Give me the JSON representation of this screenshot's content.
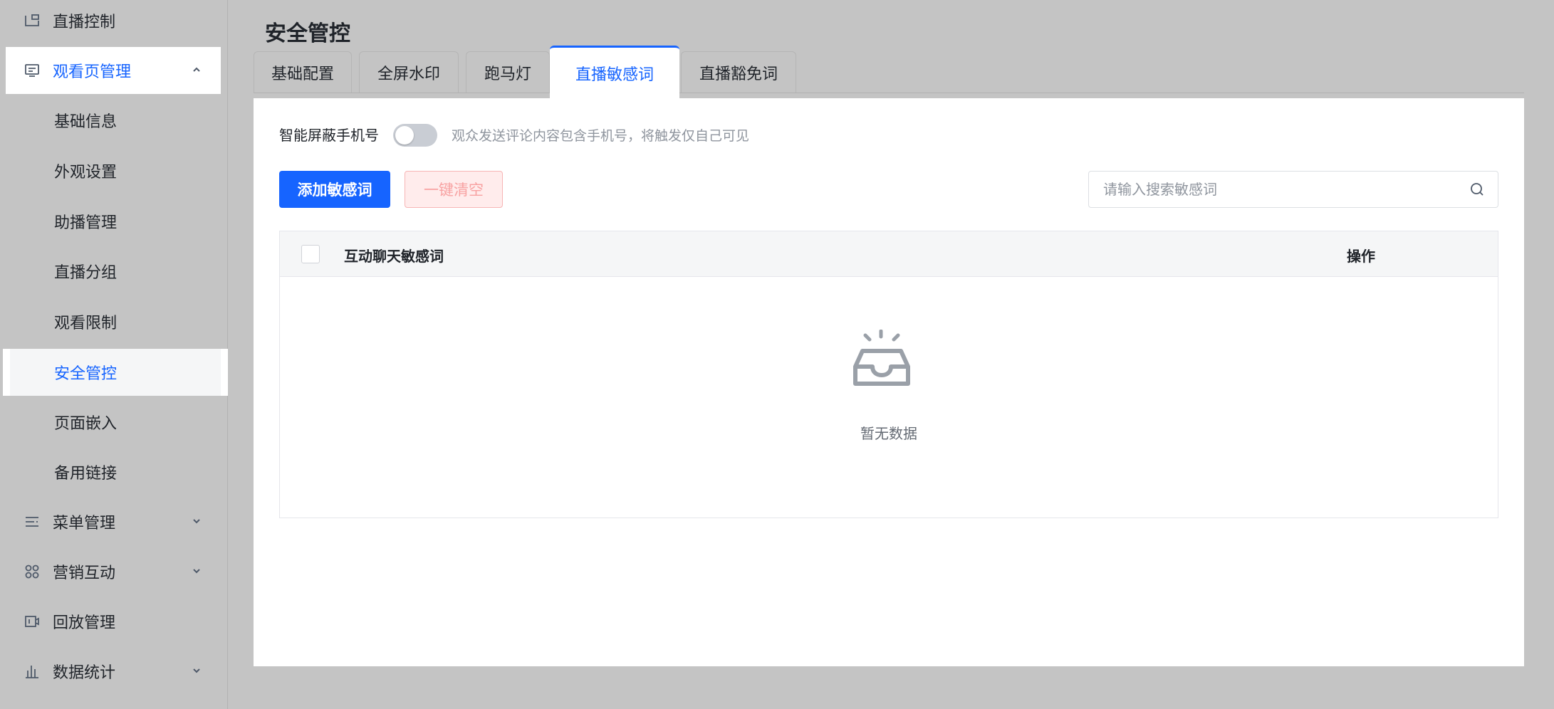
{
  "sidebar": {
    "items": [
      {
        "label": "直播控制",
        "icon": "live-control-icon"
      },
      {
        "label": "观看页管理",
        "icon": "watch-page-icon",
        "expanded": true
      },
      {
        "label": "菜单管理",
        "icon": "menu-icon"
      },
      {
        "label": "营销互动",
        "icon": "marketing-icon"
      },
      {
        "label": "回放管理",
        "icon": "playback-icon"
      },
      {
        "label": "数据统计",
        "icon": "stats-icon"
      }
    ],
    "subitems": [
      {
        "label": "基础信息"
      },
      {
        "label": "外观设置"
      },
      {
        "label": "助播管理"
      },
      {
        "label": "直播分组"
      },
      {
        "label": "观看限制"
      },
      {
        "label": "安全管控",
        "active": true
      },
      {
        "label": "页面嵌入"
      },
      {
        "label": "备用链接"
      }
    ]
  },
  "page": {
    "title": "安全管控"
  },
  "tabs": [
    {
      "label": "基础配置"
    },
    {
      "label": "全屏水印"
    },
    {
      "label": "跑马灯"
    },
    {
      "label": "直播敏感词",
      "active": true
    },
    {
      "label": "直播豁免词"
    }
  ],
  "panel": {
    "toggle_label": "智能屏蔽手机号",
    "toggle_on": false,
    "toggle_hint": "观众发送评论内容包含手机号，将触发仅自己可见",
    "add_button": "添加敏感词",
    "clear_button": "一键清空",
    "search_placeholder": "请输入搜索敏感词",
    "table": {
      "columns": [
        "互动聊天敏感词",
        "操作"
      ],
      "rows": [],
      "empty_text": "暂无数据"
    }
  },
  "colors": {
    "accent": "#1664ff",
    "danger_text": "#f8a2a2",
    "background": "#c4c4c4"
  }
}
